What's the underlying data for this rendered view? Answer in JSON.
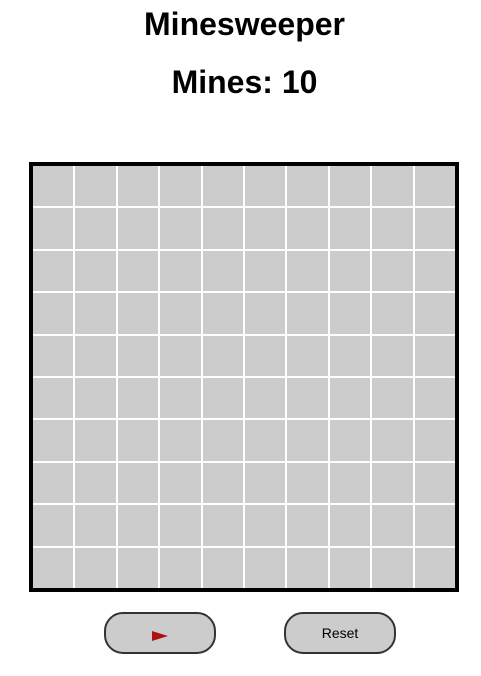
{
  "game": {
    "title": "Minesweeper",
    "mines_label": "Mines: 10",
    "mine_count": 10,
    "board": {
      "rows": 10,
      "cols": 10,
      "cell_state": "covered",
      "cell_color": "#cccccc"
    }
  },
  "controls": {
    "flag_icon": "flag-icon",
    "flag_color": "#b01010",
    "reset_label": "Reset"
  }
}
